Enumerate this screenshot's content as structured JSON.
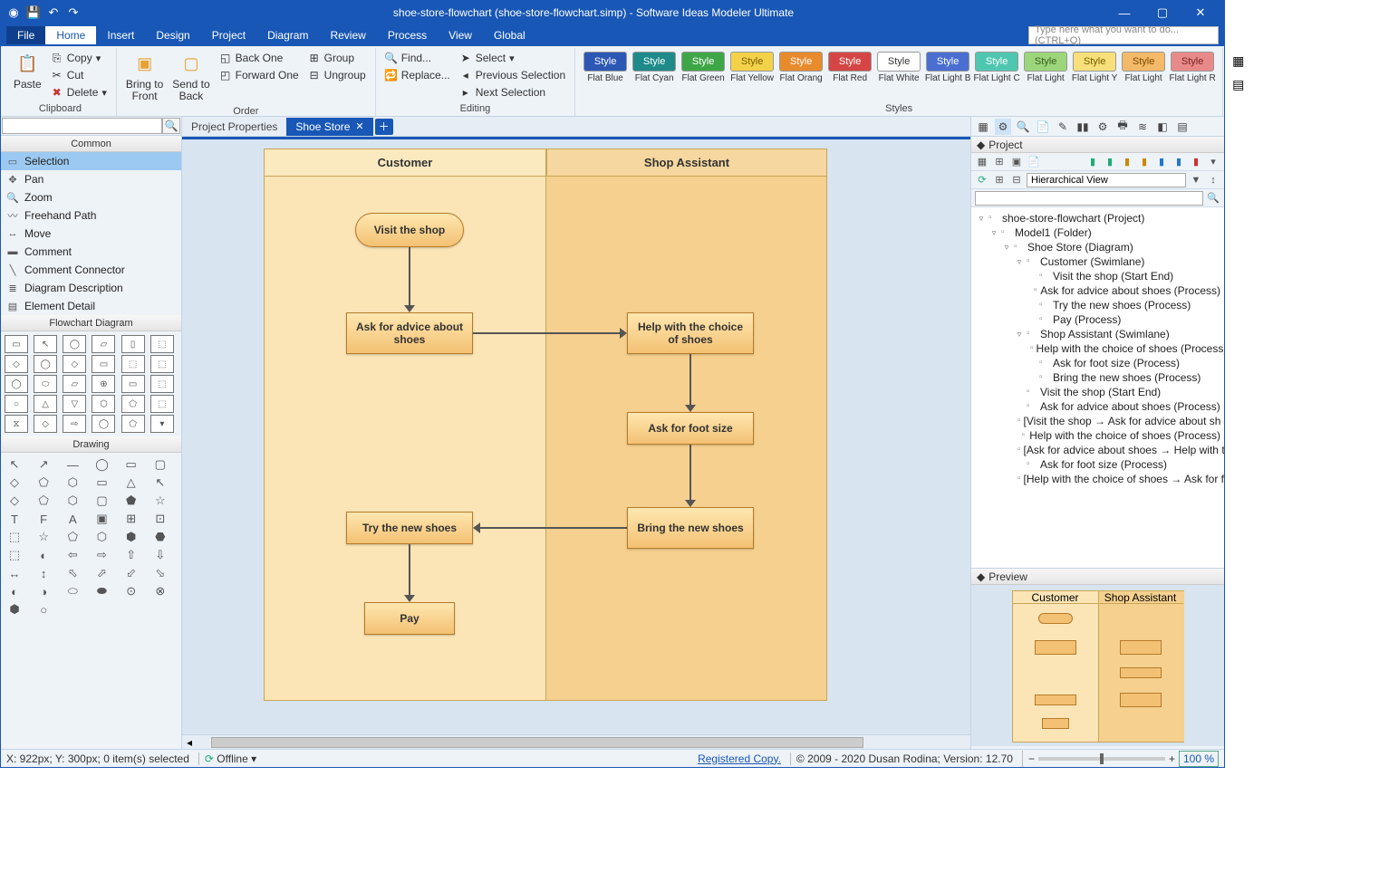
{
  "title": "shoe-store-flowchart (shoe-store-flowchart.simp)  -  Software Ideas Modeler Ultimate",
  "menu": {
    "file": "File",
    "items": [
      "Home",
      "Insert",
      "Design",
      "Project",
      "Diagram",
      "Review",
      "Process",
      "View",
      "Global"
    ],
    "active": "Home",
    "searchPlaceholder": "Type here what you want to do...   (CTRL+Q)"
  },
  "ribbon": {
    "clipboard": {
      "paste": "Paste",
      "copy": "Copy",
      "cut": "Cut",
      "delete": "Delete",
      "label": "Clipboard"
    },
    "order": {
      "bringFront": "Bring to\nFront",
      "sendBack": "Send to\nBack",
      "backOne": "Back One",
      "forwardOne": "Forward One",
      "group": "Group",
      "ungroup": "Ungroup",
      "label": "Order"
    },
    "editing": {
      "find": "Find...",
      "replace": "Replace...",
      "select": "Select",
      "prevSel": "Previous Selection",
      "nextSel": "Next Selection",
      "label": "Editing"
    },
    "styles": {
      "items": [
        {
          "name": "Flat Blue",
          "bg": "#2c57b5",
          "fg": "#fff"
        },
        {
          "name": "Flat Cyan",
          "bg": "#1f8a8a",
          "fg": "#fff"
        },
        {
          "name": "Flat Green",
          "bg": "#3fa648",
          "fg": "#fff"
        },
        {
          "name": "Flat Yellow",
          "bg": "#f3d24a",
          "fg": "#7a5c00"
        },
        {
          "name": "Flat Orang",
          "bg": "#e88b2d",
          "fg": "#fff"
        },
        {
          "name": "Flat Red",
          "bg": "#d64545",
          "fg": "#fff"
        },
        {
          "name": "Flat White",
          "bg": "#fff",
          "fg": "#333",
          "border": "#999"
        },
        {
          "name": "Flat Light B",
          "bg": "#4a6fd1",
          "fg": "#fff"
        },
        {
          "name": "Flat Light C",
          "bg": "#4fc7b0",
          "fg": "#fff"
        },
        {
          "name": "Flat Light",
          "bg": "#9cd67a",
          "fg": "#3a5c1f"
        },
        {
          "name": "Flat Light Y",
          "bg": "#f7e07a",
          "fg": "#7a5c00"
        },
        {
          "name": "Flat Light",
          "bg": "#f5b96a",
          "fg": "#7a4a00"
        },
        {
          "name": "Flat Light R",
          "bg": "#e88a8a",
          "fg": "#7a1f1f"
        }
      ],
      "label": "Styles"
    }
  },
  "leftTools": {
    "common": {
      "label": "Common",
      "items": [
        "Selection",
        "Pan",
        "Zoom",
        "Freehand Path",
        "Move",
        "Comment",
        "Comment Connector",
        "Diagram Description",
        "Element Detail"
      ],
      "icons": [
        "▭",
        "✥",
        "🔍",
        "〰",
        "↔",
        "▬",
        "╲",
        "≣",
        "▤"
      ]
    },
    "flow": {
      "label": "Flowchart Diagram"
    },
    "draw": {
      "label": "Drawing"
    }
  },
  "tabs": {
    "props": "Project Properties",
    "doc": "Shoe Store"
  },
  "swimlanes": {
    "customer": "Customer",
    "assistant": "Shop Assistant"
  },
  "nodes": {
    "visit": "Visit the shop",
    "ask": "Ask for advice about shoes",
    "help": "Help with the choice of shoes",
    "foot": "Ask for foot size",
    "bring": "Bring the new shoes",
    "try": "Try the new shoes",
    "pay": "Pay"
  },
  "project": {
    "panelLabel": "Project",
    "view": "Hierarchical View",
    "tree": [
      {
        "l": 0,
        "t": "shoe-store-flowchart (Project)",
        "exp": "▿"
      },
      {
        "l": 1,
        "t": "Model1 (Folder)",
        "exp": "▿"
      },
      {
        "l": 2,
        "t": "Shoe Store (Diagram)",
        "exp": "▿"
      },
      {
        "l": 3,
        "t": "Customer (Swimlane)",
        "exp": "▿"
      },
      {
        "l": 4,
        "t": "Visit the shop (Start End)"
      },
      {
        "l": 4,
        "t": "Ask for advice about shoes (Process)"
      },
      {
        "l": 4,
        "t": "Try the new shoes (Process)"
      },
      {
        "l": 4,
        "t": "Pay (Process)"
      },
      {
        "l": 3,
        "t": "Shop Assistant (Swimlane)",
        "exp": "▿"
      },
      {
        "l": 4,
        "t": "Help with the choice of shoes (Process)"
      },
      {
        "l": 4,
        "t": "Ask for foot size (Process)"
      },
      {
        "l": 4,
        "t": "Bring the new shoes (Process)"
      },
      {
        "l": 3,
        "t": "Visit the shop (Start End)"
      },
      {
        "l": 3,
        "t": "Ask for advice about shoes (Process)"
      },
      {
        "l": 3,
        "t": "[Visit the shop → Ask for advice about sh"
      },
      {
        "l": 3,
        "t": "Help with the choice of shoes (Process)"
      },
      {
        "l": 3,
        "t": "[Ask for advice about shoes → Help with t"
      },
      {
        "l": 3,
        "t": "Ask for foot size (Process)"
      },
      {
        "l": 3,
        "t": "[Help with the choice of shoes → Ask for f"
      }
    ]
  },
  "preview": {
    "label": "Preview"
  },
  "status": {
    "coords": "X: 922px; Y: 300px; 0 item(s) selected",
    "offline": "Offline",
    "reg": "Registered Copy.",
    "copy": "© 2009 - 2020 Dusan Rodina; Version: 12.70",
    "zoom": "100 %"
  }
}
